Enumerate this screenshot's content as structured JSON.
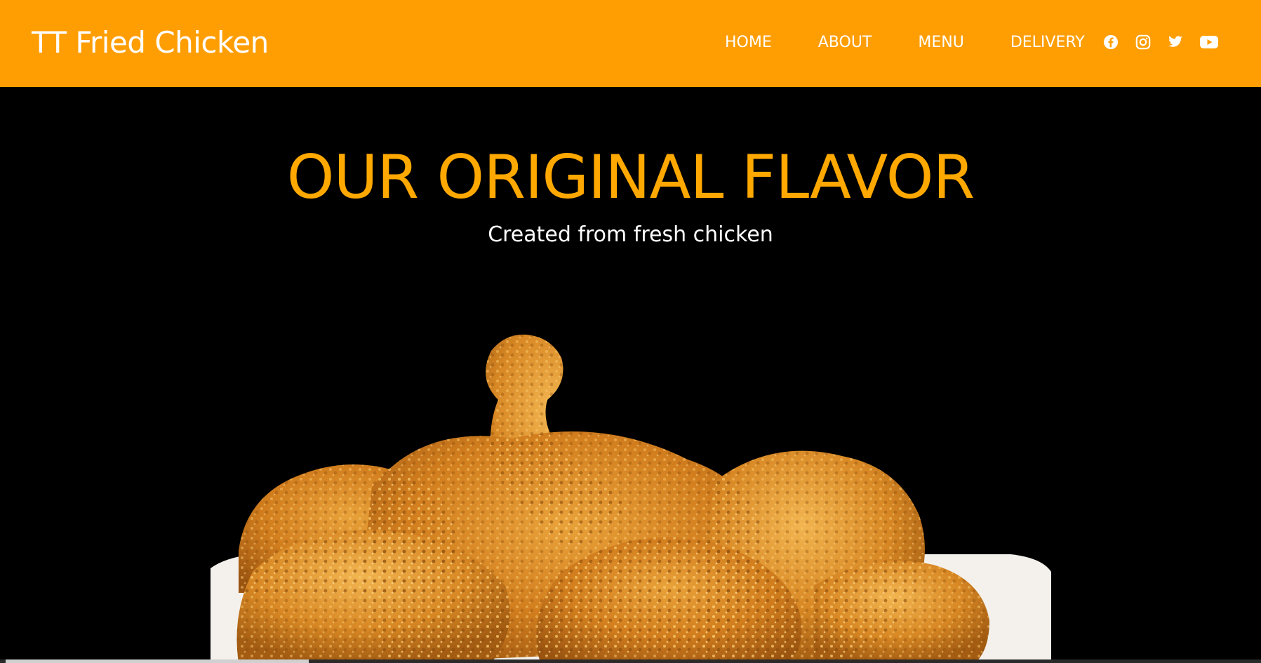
{
  "brand": {
    "name": "TT Fried Chicken"
  },
  "nav": {
    "items": [
      {
        "label": "HOME"
      },
      {
        "label": "ABOUT"
      },
      {
        "label": "MENU"
      },
      {
        "label": "DELIVERY"
      }
    ]
  },
  "social": {
    "icons": [
      "facebook-icon",
      "instagram-icon",
      "twitter-icon",
      "youtube-icon"
    ]
  },
  "hero": {
    "title": "OUR ORIGINAL FLAVOR",
    "subtitle": "Created from fresh chicken"
  },
  "colors": {
    "header_bg": "#ff9e03",
    "title_color": "#ffa800",
    "page_bg": "#000000",
    "nav_text": "#ffffff"
  }
}
